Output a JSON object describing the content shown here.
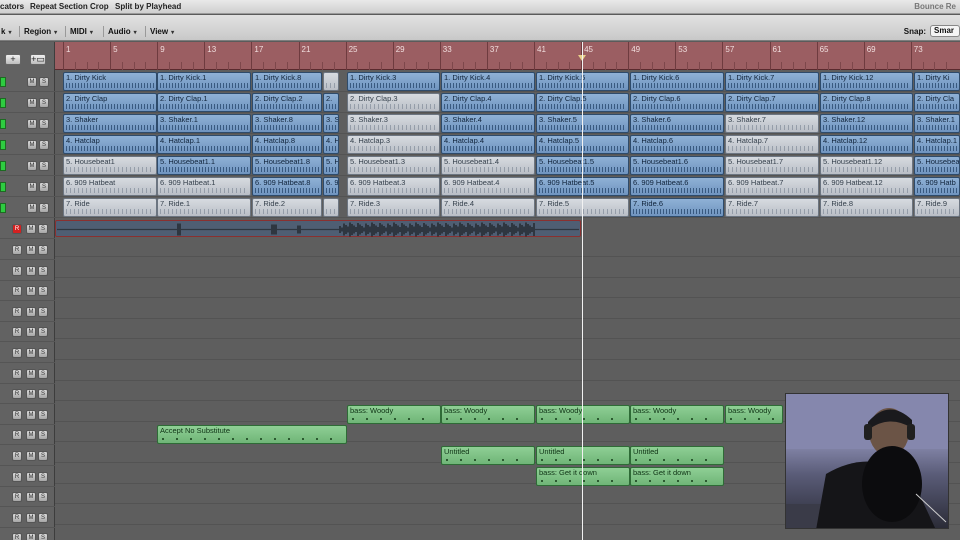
{
  "topmenu": {
    "items": [
      "cators",
      "Repeat Section",
      "Crop",
      "Split by Playhead"
    ],
    "right_label": "Bounce Re"
  },
  "toolbar": {
    "menus": [
      "k",
      "Region",
      "MIDI",
      "Audio",
      "View"
    ],
    "snap_label": "Snap:",
    "snap_value": "Smar"
  },
  "track_header": {
    "add_label": "+",
    "add2_label": "+▭",
    "mute_label": "M",
    "solo_label": "S",
    "record_label": "R"
  },
  "ruler": {
    "bars": [
      "1",
      "5",
      "9",
      "13",
      "17",
      "21",
      "25",
      "29",
      "33",
      "37",
      "41",
      "45",
      "49",
      "53",
      "57",
      "61",
      "65",
      "69",
      "73"
    ]
  },
  "drum_tracks": [
    {
      "regions": [
        {
          "label": "1. Dirty Kick",
          "style": "blue"
        },
        {
          "label": "1. Dirty Kick.1",
          "style": "blue"
        },
        {
          "label": "1. Dirty Kick.8",
          "style": "blue"
        },
        {
          "label": "",
          "style": "grey"
        },
        {
          "label": "1. Dirty Kick.3",
          "style": "blue"
        },
        {
          "label": "1. Dirty Kick.4",
          "style": "blue"
        },
        {
          "label": "1. Dirty Kick.5",
          "style": "blue"
        },
        {
          "label": "1. Dirty Kick.6",
          "style": "blue"
        },
        {
          "label": "1. Dirty Kick.7",
          "style": "blue"
        },
        {
          "label": "1. Dirty Kick.12",
          "style": "blue"
        },
        {
          "label": "1. Dirty Ki",
          "style": "blue"
        }
      ]
    },
    {
      "regions": [
        {
          "label": "2. Dirty Clap",
          "style": "blue"
        },
        {
          "label": "2. Dirty Clap.1",
          "style": "blue"
        },
        {
          "label": "2. Dirty Clap.2",
          "style": "blue"
        },
        {
          "label": "2.",
          "style": "blue"
        },
        {
          "label": "2. Dirty Clap.3",
          "style": "grey"
        },
        {
          "label": "2. Dirty Clap.4",
          "style": "blue"
        },
        {
          "label": "2. Dirty Clap.5",
          "style": "blue"
        },
        {
          "label": "2. Dirty Clap.6",
          "style": "blue"
        },
        {
          "label": "2. Dirty Clap.7",
          "style": "blue"
        },
        {
          "label": "2. Dirty Clap.8",
          "style": "blue"
        },
        {
          "label": "2. Dirty Cla",
          "style": "blue"
        }
      ]
    },
    {
      "regions": [
        {
          "label": "3. Shaker",
          "style": "blue"
        },
        {
          "label": "3. Shaker.1",
          "style": "blue"
        },
        {
          "label": "3. Shaker.8",
          "style": "blue"
        },
        {
          "label": "3. S",
          "style": "blue"
        },
        {
          "label": "3. Shaker.3",
          "style": "grey"
        },
        {
          "label": "3. Shaker.4",
          "style": "blue"
        },
        {
          "label": "3. Shaker.5",
          "style": "blue"
        },
        {
          "label": "3. Shaker.6",
          "style": "blue"
        },
        {
          "label": "3. Shaker.7",
          "style": "grey"
        },
        {
          "label": "3. Shaker.12",
          "style": "blue"
        },
        {
          "label": "3. Shaker.1",
          "style": "blue"
        }
      ]
    },
    {
      "regions": [
        {
          "label": "4. Hatclap",
          "style": "blue"
        },
        {
          "label": "4. Hatclap.1",
          "style": "blue"
        },
        {
          "label": "4. Hatclap.8",
          "style": "blue"
        },
        {
          "label": "4. H",
          "style": "blue"
        },
        {
          "label": "4. Hatclap.3",
          "style": "grey"
        },
        {
          "label": "4. Hatclap.4",
          "style": "blue"
        },
        {
          "label": "4. Hatclap.5",
          "style": "blue"
        },
        {
          "label": "4. Hatclap.6",
          "style": "blue"
        },
        {
          "label": "4. Hatclap.7",
          "style": "grey"
        },
        {
          "label": "4. Hatclap.12",
          "style": "blue"
        },
        {
          "label": "4. Hatclap.1",
          "style": "blue"
        }
      ]
    },
    {
      "regions": [
        {
          "label": "5. Housebeat1",
          "style": "grey"
        },
        {
          "label": "5. Housebeat1.1",
          "style": "blue"
        },
        {
          "label": "5. Housebeat1.8",
          "style": "blue"
        },
        {
          "label": "5. H",
          "style": "blue"
        },
        {
          "label": "5. Housebeat1.3",
          "style": "grey"
        },
        {
          "label": "5. Housebeat1.4",
          "style": "grey"
        },
        {
          "label": "5. Housebeat1.5",
          "style": "blue"
        },
        {
          "label": "5. Housebeat1.6",
          "style": "blue"
        },
        {
          "label": "5. Housebeat1.7",
          "style": "grey"
        },
        {
          "label": "5. Housebeat1.12",
          "style": "grey"
        },
        {
          "label": "5. Housebea",
          "style": "blue"
        }
      ]
    },
    {
      "regions": [
        {
          "label": "6. 909 Hatbeat",
          "style": "grey"
        },
        {
          "label": "6. 909 Hatbeat.1",
          "style": "grey"
        },
        {
          "label": "6. 909 Hatbeat.8",
          "style": "blue"
        },
        {
          "label": "6. 9",
          "style": "blue"
        },
        {
          "label": "6. 909 Hatbeat.3",
          "style": "grey"
        },
        {
          "label": "6. 909 Hatbeat.4",
          "style": "grey"
        },
        {
          "label": "6. 909 Hatbeat.5",
          "style": "blue"
        },
        {
          "label": "6. 909 Hatbeat.6",
          "style": "blue"
        },
        {
          "label": "6. 909 Hatbeat.7",
          "style": "grey"
        },
        {
          "label": "6. 909 Hatbeat.12",
          "style": "grey"
        },
        {
          "label": "6. 909 Hatb",
          "style": "blue"
        }
      ]
    },
    {
      "regions": [
        {
          "label": "7. Ride",
          "style": "grey"
        },
        {
          "label": "7. Ride.1",
          "style": "grey"
        },
        {
          "label": "7. Ride.2",
          "style": "grey"
        },
        {
          "label": "",
          "style": "grey"
        },
        {
          "label": "7. Ride.3",
          "style": "grey"
        },
        {
          "label": "7. Ride.4",
          "style": "grey"
        },
        {
          "label": "7. Ride.5",
          "style": "grey"
        },
        {
          "label": "7. Ride.6",
          "style": "blue"
        },
        {
          "label": "7. Ride.7",
          "style": "grey"
        },
        {
          "label": "7. Ride.8",
          "style": "grey"
        },
        {
          "label": "7. Ride.9",
          "style": "grey"
        }
      ]
    }
  ],
  "midi_regions": {
    "bass_woody": [
      "bass: Woody",
      "bass: Woody",
      "bass: Woody",
      "bass: Woody",
      "bass: Woody"
    ],
    "accept": "Accept No Substitute",
    "untitled": [
      "Untitled",
      "Untitled",
      "Untitled"
    ],
    "get_it_down": [
      "bass: Get it down",
      "bass: Get it down"
    ]
  },
  "colors": {
    "drum_region": "#7fa3cc",
    "muted_region": "#c8ccd3",
    "midi_region": "#7fc387",
    "ruler": "#9b5e62",
    "arrange_bg": "#5e5e5e"
  }
}
